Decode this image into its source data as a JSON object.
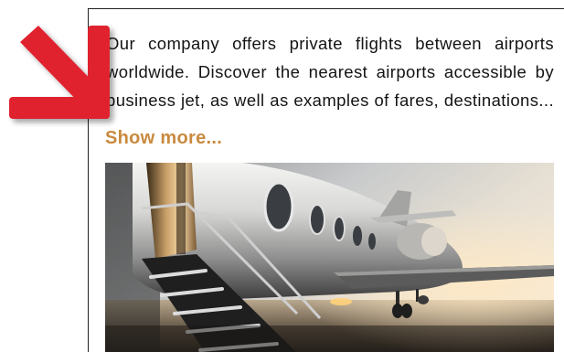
{
  "article": {
    "description_lines": [
      "Our company offers private flights between airports",
      "worldwide. Discover the nearest airports accessible by",
      "business jet, as well as examples of fares, destinations..."
    ],
    "show_more_label": "Show more..."
  },
  "colors": {
    "link": "#c98a3f",
    "arrow": "#e0202e",
    "text": "#141414"
  },
  "icons": {
    "pointer": "red-diagonal-arrow-icon"
  }
}
